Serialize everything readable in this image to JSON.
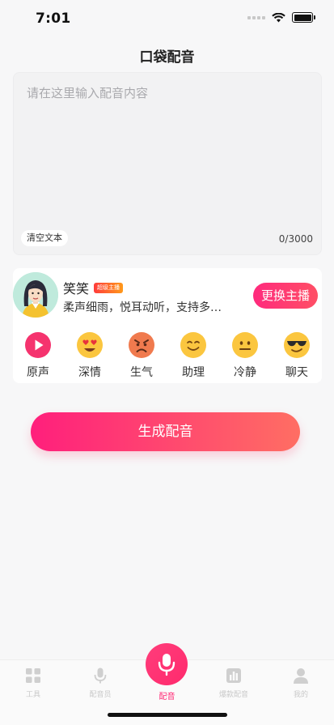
{
  "status_bar": {
    "time": "7:01"
  },
  "header": {
    "title": "口袋配音"
  },
  "editor": {
    "placeholder": "请在这里输入配音内容",
    "clear_label": "清空文本",
    "char_count": "0/3000"
  },
  "voice": {
    "name": "笑笑",
    "badge": "超级主播",
    "description": "柔声细雨，悦耳动听，支持多…",
    "change_label": "更换主播"
  },
  "emotions": [
    {
      "label": "原声",
      "icon": "play-icon"
    },
    {
      "label": "深情",
      "icon": "heart-eyes-icon"
    },
    {
      "label": "生气",
      "icon": "angry-face-icon"
    },
    {
      "label": "助理",
      "icon": "smile-face-icon"
    },
    {
      "label": "冷静",
      "icon": "neutral-face-icon"
    },
    {
      "label": "聊天",
      "icon": "sunglasses-face-icon"
    }
  ],
  "generate": {
    "label": "生成配音"
  },
  "tabs": [
    {
      "label": "工具",
      "icon": "grid-icon"
    },
    {
      "label": "配音员",
      "icon": "mic-icon"
    },
    {
      "label": "配音",
      "icon": "mic-icon",
      "active": true
    },
    {
      "label": "爆款配音",
      "icon": "chart-icon"
    },
    {
      "label": "我的",
      "icon": "person-icon"
    }
  ],
  "colors": {
    "accent": "#ff2a75",
    "accent_end": "#ff6e63"
  }
}
